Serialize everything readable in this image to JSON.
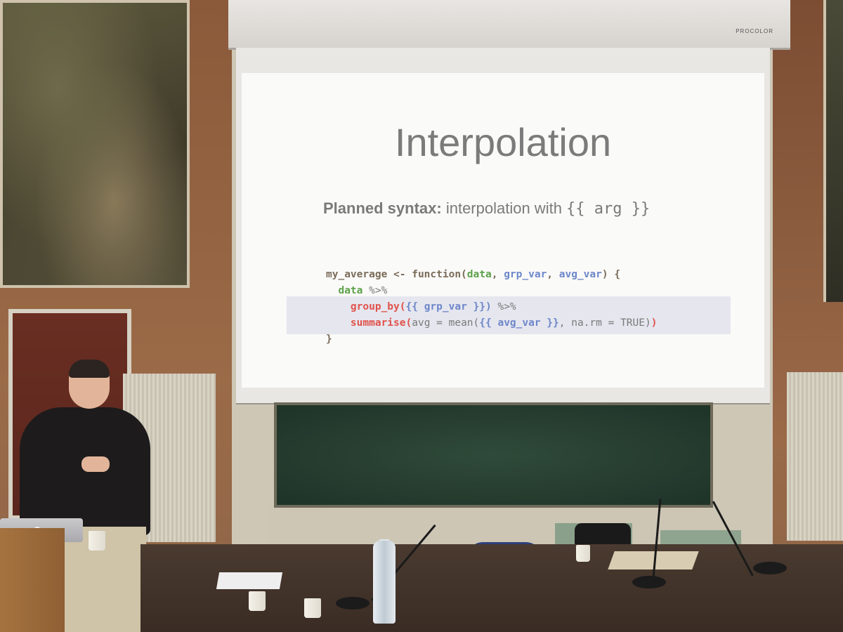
{
  "slide": {
    "title": "Interpolation",
    "subtitle_bold": "Planned syntax:",
    "subtitle_text": " interpolation with ",
    "subtitle_code": "{{ arg }}"
  },
  "code": {
    "line1_name": "my_average <- ",
    "line1_fn": "function(",
    "line1_data": "data",
    "line1_sep1": ", ",
    "line1_grp": "grp_var",
    "line1_sep2": ", ",
    "line1_avg": "avg_var",
    "line1_close": ") {",
    "line2_indent": "  ",
    "line2_data": "data",
    "line2_pipe": " %>%",
    "line3_indent": "    ",
    "line3_fn": "group_by(",
    "line3_open": "{{ ",
    "line3_arg": "grp_var",
    "line3_close": " }})",
    "line3_pipe": " %>%",
    "line4_indent": "    ",
    "line4_fn": "summarise(",
    "line4_mid": "avg = mean(",
    "line4_open": "{{ ",
    "line4_arg": "avg_var",
    "line4_close": " }}",
    "line4_rest": ", na.rm = TRUE)",
    "line4_end": ")",
    "line5": "}"
  },
  "housing": {
    "brand": "PROCOLOR"
  },
  "colors": {
    "slide_bg": "#fafaf8",
    "title": "#7b7b7b",
    "green": "#5da14a",
    "blue": "#6d87c9",
    "red": "#e0524a"
  }
}
